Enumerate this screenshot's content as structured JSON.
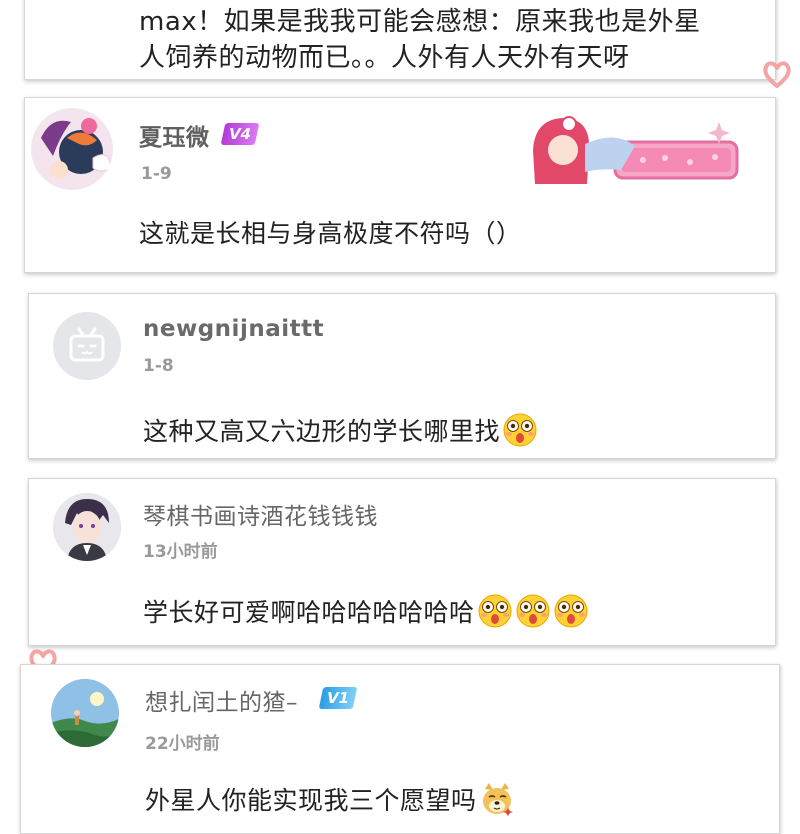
{
  "colors": {
    "vip4": "#c23bd6",
    "vip1": "#3aa7ea",
    "heart": "#f5a3a3",
    "date": "#9a9a9a"
  },
  "comments": [
    {
      "body_line1": "max！如果是我我可能会感想：原来我也是外星",
      "body_line2": "人饲养的动物而已。。人外有人天外有天呀"
    },
    {
      "username": "夏珏微",
      "level": "V4",
      "date": "1-9",
      "text": "这就是长相与身高极度不符吗（）",
      "avatar_icon": "anime-avatar-icon",
      "decoration_icon": "anime-badge-decoration-icon"
    },
    {
      "username": "newgnijnaittt",
      "date": "1-8",
      "text": "这种又高又六边形的学长哪里找",
      "avatar_icon": "default-tv-avatar-icon",
      "emojis": [
        "astonished-emoji"
      ]
    },
    {
      "username": "琴棋书画诗酒花钱钱钱",
      "date": "13小时前",
      "text": "学长好可爱啊哈哈哈哈哈哈哈",
      "avatar_icon": "anime-boy-avatar-icon",
      "emojis": [
        "astonished-emoji",
        "astonished-emoji",
        "astonished-emoji"
      ]
    },
    {
      "username": "想扎闰土的猹–",
      "level": "V1",
      "date": "22小时前",
      "text": "外星人你能实现我三个愿望吗",
      "avatar_icon": "landscape-avatar-icon",
      "emojis": [
        "doge-emoji"
      ]
    }
  ]
}
